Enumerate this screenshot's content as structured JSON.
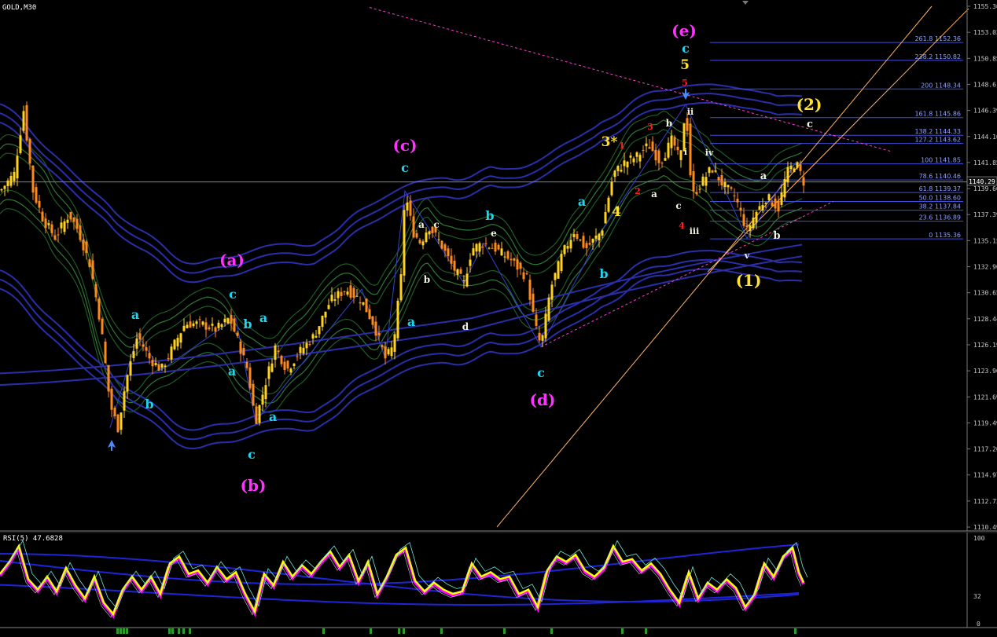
{
  "window": {
    "title": "GOLD,M30"
  },
  "colors": {
    "background": "#000000",
    "candle_up": "#ffd21e",
    "candle_down": "#ff8a1c",
    "bands_green": "#1f5a24",
    "bands_blue": "#2a2ea8",
    "fib_line": "#3f4fd8",
    "trend_pink": "#ff3fd0",
    "channel_orange": "#ffb468",
    "rsi_line": "#ffff00",
    "rsi_shadow": "#ff00ff",
    "wave_magenta": "#ff33ff",
    "wave_cyan": "#22d3ee",
    "wave_yellow": "#ffe033",
    "wave_white": "#f2f2e0",
    "wave_red": "#ff2020"
  },
  "chart_data": {
    "type": "candlestick",
    "symbol": "GOLD",
    "timeframe": "M30",
    "ylim": [
      1110.4,
      1155.5
    ],
    "y_ticks": [
      "1155.30",
      "1153.02",
      "1150.85",
      "1148.61",
      "1146.39",
      "1144.16",
      "1141.85",
      "1139.60",
      "1137.39",
      "1135.15",
      "1132.90",
      "1130.65",
      "1128.44",
      "1126.19",
      "1123.96",
      "1121.69",
      "1119.49",
      "1117.20",
      "1114.97",
      "1112.73",
      "1110.49"
    ],
    "current_price_label": "1140.29",
    "current_price": 1140.29,
    "price_path": [
      [
        0,
        1139.5
      ],
      [
        18,
        1141
      ],
      [
        30,
        1146.5
      ],
      [
        42,
        1139.5
      ],
      [
        55,
        1137
      ],
      [
        70,
        1135.5
      ],
      [
        88,
        1137.5
      ],
      [
        100,
        1136
      ],
      [
        115,
        1133
      ],
      [
        128,
        1128
      ],
      [
        140,
        1121
      ],
      [
        150,
        1119
      ],
      [
        160,
        1123
      ],
      [
        175,
        1127
      ],
      [
        190,
        1125
      ],
      [
        205,
        1124
      ],
      [
        220,
        1126
      ],
      [
        235,
        1128
      ],
      [
        255,
        1128
      ],
      [
        275,
        1127.5
      ],
      [
        292,
        1128.5
      ],
      [
        300,
        1127
      ],
      [
        315,
        1124
      ],
      [
        325,
        1119.5
      ],
      [
        338,
        1123
      ],
      [
        350,
        1126
      ],
      [
        365,
        1124
      ],
      [
        380,
        1125.5
      ],
      [
        400,
        1127
      ],
      [
        420,
        1130
      ],
      [
        440,
        1131
      ],
      [
        460,
        1130
      ],
      [
        475,
        1128
      ],
      [
        490,
        1125
      ],
      [
        500,
        1126
      ],
      [
        510,
        1132
      ],
      [
        515,
        1139.5
      ],
      [
        525,
        1136
      ],
      [
        535,
        1135
      ],
      [
        545,
        1136.5
      ],
      [
        560,
        1135
      ],
      [
        575,
        1133
      ],
      [
        590,
        1131.5
      ],
      [
        600,
        1134.5
      ],
      [
        615,
        1135
      ],
      [
        630,
        1134.5
      ],
      [
        650,
        1133.5
      ],
      [
        670,
        1132
      ],
      [
        680,
        1128
      ],
      [
        688,
        1126
      ],
      [
        700,
        1131
      ],
      [
        715,
        1134
      ],
      [
        730,
        1136
      ],
      [
        745,
        1134.5
      ],
      [
        765,
        1136
      ],
      [
        780,
        1141
      ],
      [
        795,
        1142
      ],
      [
        810,
        1142.5
      ],
      [
        825,
        1143.5
      ],
      [
        840,
        1142
      ],
      [
        855,
        1144
      ],
      [
        865,
        1142
      ],
      [
        872,
        1147
      ],
      [
        880,
        1139
      ],
      [
        890,
        1140
      ],
      [
        905,
        1141.5
      ],
      [
        920,
        1140
      ],
      [
        935,
        1139
      ],
      [
        950,
        1136
      ],
      [
        960,
        1137.5
      ],
      [
        975,
        1139
      ],
      [
        990,
        1138
      ],
      [
        1000,
        1141
      ],
      [
        1012,
        1142
      ],
      [
        1022,
        1140.3
      ]
    ],
    "rsi": {
      "label": "RSI(5) 47.6828",
      "period": 5,
      "value": 47.6828,
      "ticks": [
        "100",
        "32",
        "0"
      ],
      "path": [
        [
          0,
          58
        ],
        [
          12,
          72
        ],
        [
          24,
          90
        ],
        [
          36,
          52
        ],
        [
          48,
          40
        ],
        [
          60,
          55
        ],
        [
          72,
          38
        ],
        [
          84,
          65
        ],
        [
          96,
          45
        ],
        [
          108,
          30
        ],
        [
          120,
          55
        ],
        [
          132,
          25
        ],
        [
          144,
          12
        ],
        [
          156,
          40
        ],
        [
          168,
          55
        ],
        [
          180,
          40
        ],
        [
          192,
          55
        ],
        [
          204,
          35
        ],
        [
          216,
          70
        ],
        [
          228,
          78
        ],
        [
          240,
          58
        ],
        [
          252,
          62
        ],
        [
          264,
          48
        ],
        [
          276,
          66
        ],
        [
          288,
          52
        ],
        [
          300,
          60
        ],
        [
          312,
          35
        ],
        [
          324,
          15
        ],
        [
          336,
          58
        ],
        [
          348,
          45
        ],
        [
          360,
          72
        ],
        [
          372,
          55
        ],
        [
          384,
          68
        ],
        [
          396,
          58
        ],
        [
          408,
          72
        ],
        [
          420,
          84
        ],
        [
          432,
          66
        ],
        [
          444,
          80
        ],
        [
          456,
          50
        ],
        [
          468,
          72
        ],
        [
          480,
          35
        ],
        [
          492,
          55
        ],
        [
          504,
          80
        ],
        [
          516,
          88
        ],
        [
          528,
          50
        ],
        [
          540,
          38
        ],
        [
          552,
          48
        ],
        [
          564,
          40
        ],
        [
          576,
          35
        ],
        [
          588,
          38
        ],
        [
          600,
          70
        ],
        [
          612,
          55
        ],
        [
          624,
          60
        ],
        [
          636,
          52
        ],
        [
          648,
          55
        ],
        [
          660,
          35
        ],
        [
          672,
          40
        ],
        [
          684,
          20
        ],
        [
          696,
          62
        ],
        [
          708,
          78
        ],
        [
          720,
          72
        ],
        [
          732,
          80
        ],
        [
          744,
          62
        ],
        [
          756,
          55
        ],
        [
          768,
          65
        ],
        [
          780,
          90
        ],
        [
          792,
          72
        ],
        [
          804,
          75
        ],
        [
          816,
          62
        ],
        [
          828,
          70
        ],
        [
          840,
          58
        ],
        [
          852,
          40
        ],
        [
          864,
          25
        ],
        [
          876,
          60
        ],
        [
          888,
          30
        ],
        [
          900,
          48
        ],
        [
          912,
          40
        ],
        [
          924,
          52
        ],
        [
          936,
          42
        ],
        [
          948,
          20
        ],
        [
          960,
          35
        ],
        [
          972,
          70
        ],
        [
          984,
          55
        ],
        [
          996,
          78
        ],
        [
          1008,
          88
        ],
        [
          1016,
          60
        ],
        [
          1022,
          48
        ]
      ]
    }
  },
  "fib_levels": [
    {
      "label": "261.8 1152.36",
      "price": 1152.36
    },
    {
      "label": "238.2 1150.82",
      "price": 1150.82
    },
    {
      "label": "200 1148.34",
      "price": 1148.34
    },
    {
      "label": "161.8 1145.86",
      "price": 1145.86
    },
    {
      "label": "138.2 1144.33",
      "price": 1144.33
    },
    {
      "label": "127.2 1143.62",
      "price": 1143.62
    },
    {
      "label": "100 1141.85",
      "price": 1141.85
    },
    {
      "label": "78.6 1140.46",
      "price": 1140.46
    },
    {
      "label": "61.8 1139.37",
      "price": 1139.37
    },
    {
      "label": "50.0 1138.60",
      "price": 1138.6
    },
    {
      "label": "38.2 1137.84",
      "price": 1137.84
    },
    {
      "label": "23.6 1136.89",
      "price": 1136.89
    },
    {
      "label": "0 1135.36",
      "price": 1135.36
    }
  ],
  "wave_labels": [
    {
      "t": "(a)",
      "c": "magenta"
    },
    {
      "t": "(b)",
      "c": "magenta"
    },
    {
      "t": "(c)",
      "c": "magenta"
    },
    {
      "t": "(d)",
      "c": "magenta"
    },
    {
      "t": "(e)",
      "c": "magenta"
    },
    {
      "t": "a",
      "c": "cyan"
    },
    {
      "t": "b",
      "c": "cyan"
    },
    {
      "t": "c",
      "c": "cyan"
    },
    {
      "t": "b",
      "c": "cyan"
    },
    {
      "t": "a",
      "c": "cyan"
    },
    {
      "t": "a",
      "c": "cyan"
    },
    {
      "t": "c",
      "c": "cyan"
    },
    {
      "t": "a",
      "c": "cyan"
    },
    {
      "t": "c",
      "c": "cyan"
    },
    {
      "t": "a",
      "c": "cyan"
    },
    {
      "t": "c",
      "c": "cyan"
    },
    {
      "t": "b",
      "c": "cyan"
    },
    {
      "t": "a",
      "c": "cyan"
    },
    {
      "t": "b",
      "c": "cyan"
    },
    {
      "t": "c",
      "c": "cyan"
    },
    {
      "t": "c",
      "c": "cyan"
    },
    {
      "t": "a",
      "c": "white"
    },
    {
      "t": "c",
      "c": "white"
    },
    {
      "t": "b",
      "c": "white"
    },
    {
      "t": "d",
      "c": "white"
    },
    {
      "t": "e",
      "c": "white"
    },
    {
      "t": "a",
      "c": "white"
    },
    {
      "t": "b",
      "c": "white"
    },
    {
      "t": "c",
      "c": "white"
    },
    {
      "t": "ii",
      "c": "white"
    },
    {
      "t": "i",
      "c": "white"
    },
    {
      "t": "iii",
      "c": "white"
    },
    {
      "t": "iv",
      "c": "white"
    },
    {
      "t": "v",
      "c": "white"
    },
    {
      "t": "a",
      "c": "white"
    },
    {
      "t": "b",
      "c": "white"
    },
    {
      "t": "c",
      "c": "white"
    },
    {
      "t": "1",
      "c": "red"
    },
    {
      "t": "2",
      "c": "red"
    },
    {
      "t": "3",
      "c": "red"
    },
    {
      "t": "4",
      "c": "red"
    },
    {
      "t": "5",
      "c": "red"
    },
    {
      "t": "3*",
      "c": "yellow"
    },
    {
      "t": "4",
      "c": "yellow"
    },
    {
      "t": "5",
      "c": "yellow"
    },
    {
      "t": "(1)",
      "c": "yellow"
    },
    {
      "t": "(2)",
      "c": "yellow"
    }
  ]
}
